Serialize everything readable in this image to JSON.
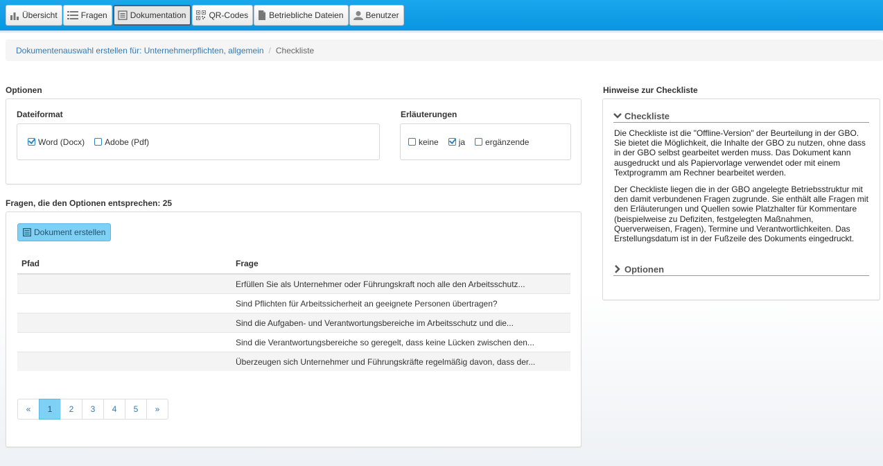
{
  "nav": {
    "tabs": [
      {
        "label": "Übersicht",
        "icon": "bar-chart-icon",
        "active": false
      },
      {
        "label": "Fragen",
        "icon": "list-icon",
        "active": false
      },
      {
        "label": "Dokumentation",
        "icon": "document-icon",
        "active": true
      },
      {
        "label": "QR-Codes",
        "icon": "qr-code-icon",
        "active": false
      },
      {
        "label": "Betriebliche Dateien",
        "icon": "file-icon",
        "active": false
      },
      {
        "label": "Benutzer",
        "icon": "user-icon",
        "active": false
      }
    ]
  },
  "breadcrumb": {
    "link": "Dokumentenauswahl erstellen für: Unternehmerpflichten, allgemein",
    "separator": "/",
    "current": "Checkliste"
  },
  "options": {
    "title": "Optionen",
    "dateiformat": {
      "label": "Dateiformat",
      "choices": [
        {
          "label": "Word (Docx)",
          "checked": true
        },
        {
          "label": "Adobe (Pdf)",
          "checked": false
        }
      ]
    },
    "erlaeuterungen": {
      "label": "Erläuterungen",
      "choices": [
        {
          "label": "keine",
          "checked": false
        },
        {
          "label": "ja",
          "checked": true
        },
        {
          "label": "ergänzende",
          "checked": false
        }
      ]
    }
  },
  "questions": {
    "title": "Fragen, die den Optionen entsprechen: 25",
    "create_button": "Dokument erstellen",
    "columns": [
      "Pfad",
      "Frage"
    ],
    "rows": [
      {
        "pfad": "",
        "frage": "Erfüllen Sie als Unternehmer oder Führungskraft noch alle den Arbeitsschutz..."
      },
      {
        "pfad": "",
        "frage": "Sind Pflichten für Arbeitssicherheit an geeignete Personen übertragen?"
      },
      {
        "pfad": "",
        "frage": "Sind die Aufgaben- und Verantwortungsbereiche im Arbeitsschutz und die..."
      },
      {
        "pfad": "",
        "frage": "Sind die Verantwortungsbereiche so geregelt, dass keine Lücken zwischen den..."
      },
      {
        "pfad": "",
        "frage": "Überzeugen sich Unternehmer und Führungskräfte regelmäßig davon, dass der..."
      }
    ],
    "pagination": {
      "prev": "«",
      "pages": [
        "1",
        "2",
        "3",
        "4",
        "5"
      ],
      "current": "1",
      "next": "»"
    }
  },
  "hints": {
    "title": "Hinweise zur Checkliste",
    "checkliste_header": "Checkliste",
    "paragraph1": "Die Checkliste ist die \"Offline-Version\" der Beurteilung in der GBO. Sie bietet die Möglichkeit, die Inhalte der GBO zu nutzen, ohne dass in der GBO selbst gearbeitet werden muss. Das Dokument kann ausgedruckt und als Papiervorlage verwendet oder mit einem Textprogramm am Rechner bearbeitet werden.",
    "paragraph2": "Der Checkliste liegen die in der GBO angelegte Betriebsstruktur mit den damit verbundenen Fragen zugrunde. Sie enthält alle Fragen mit den Erläuterungen und Quellen sowie Platzhalter für Kommentare (beispielweise zu Defiziten, festgelegten Maßnahmen, Querverweisen, Fragen), Termine und Verantwortlichkeiten. Das Erstellungsdatum ist in der Fußzeile des Dokuments eingedruckt.",
    "optionen_header": "Optionen"
  }
}
